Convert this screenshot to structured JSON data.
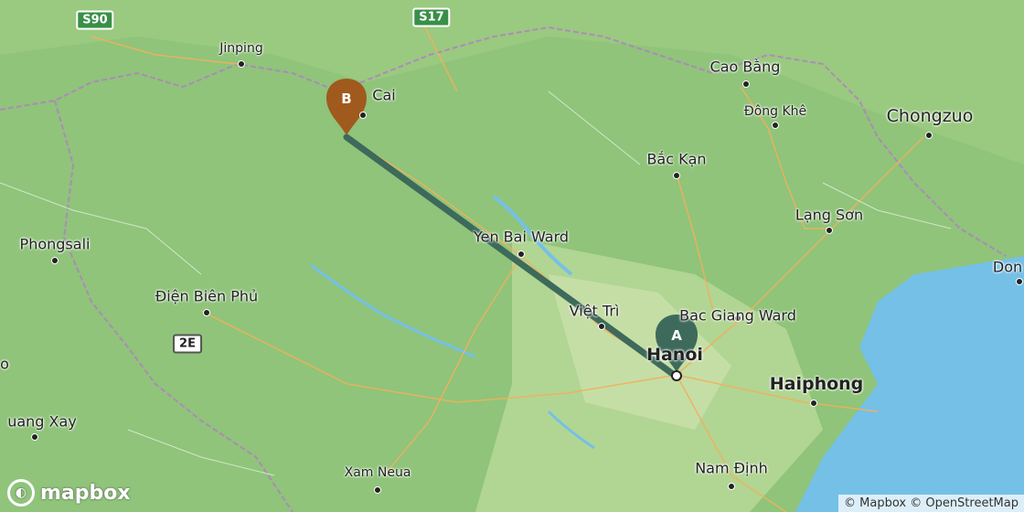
{
  "map": {
    "labels": {
      "jinping": "Jinping",
      "cai": "Cai",
      "cao_bang": "Cao Bằng",
      "dong_khe": "Đông Khê",
      "chongzuo": "Chongzuo",
      "bac_kan": "Bắc Kạn",
      "lang_son": "Lạng Sơn",
      "yen_bai": "Yen Bai Ward",
      "phongsali": "Phongsali",
      "dien_bien_phu": "Điện Biên Phủ",
      "viet_tri": "Việt Trì",
      "bac_giang": "Bac Giang Ward",
      "hanoi": "Hanoi",
      "haiphong": "Haiphong",
      "quang_xay": "uang Xay",
      "xam_neua": "Xam Neua",
      "nam_dinh": "Nam Định",
      "don": "Don",
      "zero": "o"
    },
    "shields": {
      "s90": "S90",
      "s17": "S17",
      "r2e": "2E"
    },
    "markers": {
      "a": "A",
      "b": "B"
    },
    "colors": {
      "route": "#3d6a5b",
      "marker_a": "#3d6a5b",
      "marker_b": "#a05a1e",
      "water": "#75c0e6",
      "land": "#8fc47a"
    },
    "logo_text": "mapbox",
    "attribution": "© Mapbox © OpenStreetMap"
  }
}
